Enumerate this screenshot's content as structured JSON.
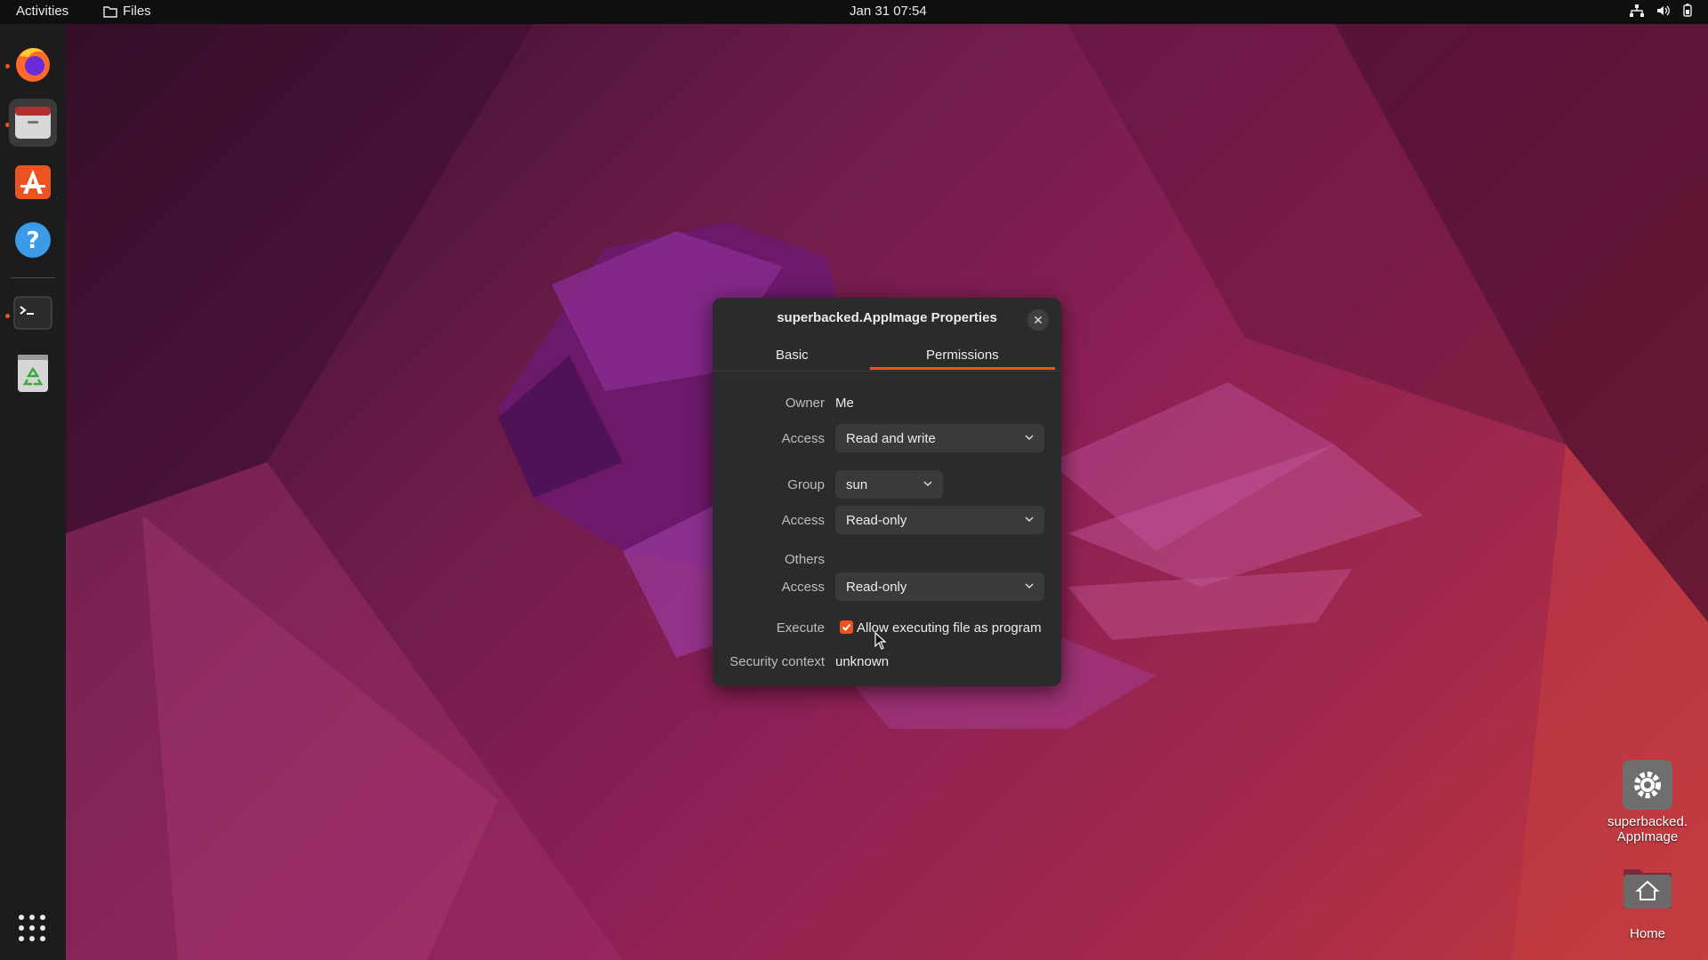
{
  "topbar": {
    "activities": "Activities",
    "app_name": "Files",
    "clock": "Jan 31  07:54",
    "status_icons": [
      "network-icon",
      "volume-icon",
      "battery-icon"
    ]
  },
  "dock": {
    "items": [
      {
        "name": "firefox-icon",
        "running": true
      },
      {
        "name": "files-icon",
        "running": true,
        "active": true
      },
      {
        "name": "app-center-icon",
        "running": false
      },
      {
        "name": "help-icon",
        "running": false
      },
      {
        "name": "terminal-icon",
        "running": true
      },
      {
        "name": "trash-icon",
        "running": false
      }
    ],
    "apps_grid": "show-apps-icon"
  },
  "dialog": {
    "title": "superbacked.AppImage Properties",
    "tabs": [
      {
        "label": "Basic",
        "selected": false
      },
      {
        "label": "Permissions",
        "selected": true
      }
    ],
    "owner_label": "Owner",
    "owner_value": "Me",
    "owner_access_label": "Access",
    "owner_access_value": "Read and write",
    "group_label": "Group",
    "group_value": "sun",
    "group_access_label": "Access",
    "group_access_value": "Read-only",
    "others_label": "Others",
    "others_access_label": "Access",
    "others_access_value": "Read-only",
    "execute_label": "Execute",
    "execute_checkbox_label": "Allow executing file as program",
    "execute_checked": true,
    "security_label": "Security context",
    "security_value": "unknown"
  },
  "desktop": {
    "icons": [
      {
        "label_line1": "superbacked.",
        "label_line2": "AppImage",
        "icon": "gear-icon"
      },
      {
        "label": "Home",
        "icon": "home-folder-icon"
      }
    ]
  },
  "colors": {
    "accent": "#e95420",
    "dialog_bg": "#2b2b2b",
    "topbar_bg": "#0f0f0f",
    "dock_bg": "#1c1c1c"
  }
}
